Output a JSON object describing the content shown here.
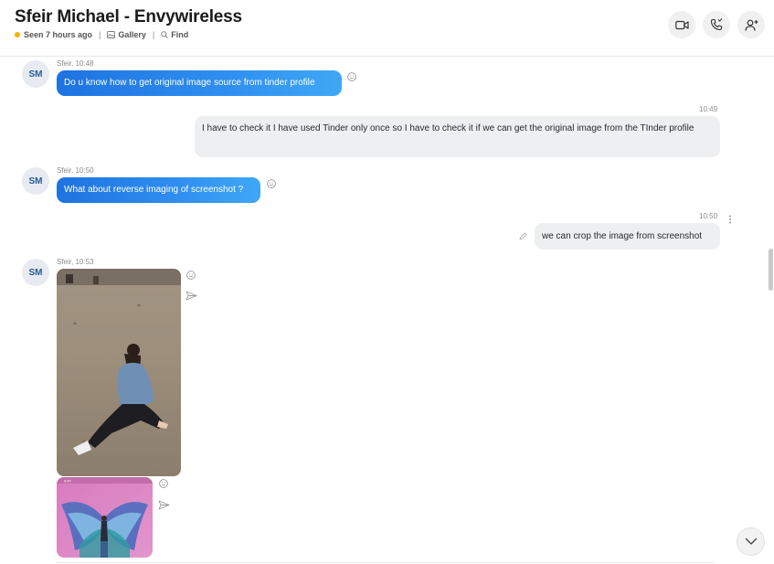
{
  "header": {
    "title": "Sfeir Michael - Envywireless",
    "seen": "Seen 7 hours ago",
    "gallery": "Gallery",
    "find": "Find"
  },
  "colors": {
    "accent": "#1e73e0",
    "presence": "#f4b400"
  },
  "messages": [
    {
      "avatar": "SM",
      "meta": "Sfeir, 10:48",
      "text": "Do u know how to get original image source  from tinder profile"
    },
    {
      "time": "10:49",
      "text": "I have to check it I have used Tinder only once so I have to check it if we can get the original image from the TInder profile"
    },
    {
      "avatar": "SM",
      "meta": "Sfeir, 10:50",
      "text": "What about reverse imaging of screenshot ?"
    },
    {
      "time": "10:50",
      "text": "we can crop the image from screenshot"
    },
    {
      "avatar": "SM",
      "meta": "Sfeir, 10:53",
      "phone_status": "9:47"
    }
  ],
  "icons": {
    "video": "video-call-icon",
    "call": "audio-call-icon",
    "add": "add-person-icon",
    "gallery": "gallery-icon",
    "find": "search-icon",
    "react": "smiley-icon",
    "forward": "forward-icon",
    "edit": "pencil-icon",
    "more": "more-dots-icon",
    "scroll": "chevron-down-icon"
  }
}
